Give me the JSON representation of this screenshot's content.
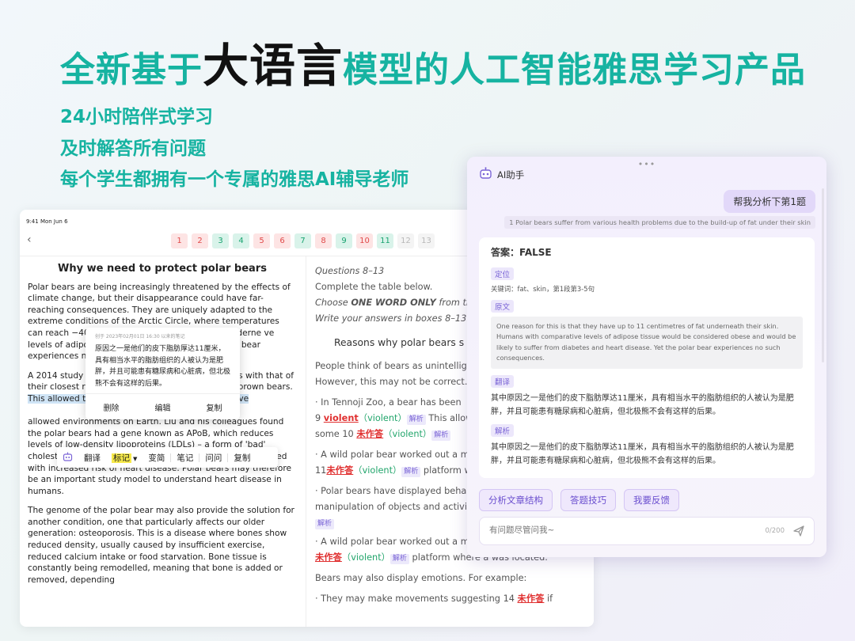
{
  "headline": {
    "pre": "全新基于",
    "em": "大语言",
    "post": "模型的人工智能雅思学习产品"
  },
  "subtitles": [
    "24小时陪伴式学习",
    "及时解答所有问题",
    "每个学生都拥有一个专属的雅思AI辅导老师"
  ],
  "tablet": {
    "status": "9:41  Mon Jun 6",
    "back_icon": "chevron-left-icon",
    "questions": [
      {
        "n": "1",
        "state": "wrong"
      },
      {
        "n": "2",
        "state": "wrong"
      },
      {
        "n": "3",
        "state": "right"
      },
      {
        "n": "4",
        "state": "right"
      },
      {
        "n": "5",
        "state": "wrong"
      },
      {
        "n": "6",
        "state": "wrong"
      },
      {
        "n": "7",
        "state": "right"
      },
      {
        "n": "8",
        "state": "wrong"
      },
      {
        "n": "9",
        "state": "right"
      },
      {
        "n": "10",
        "state": "wrong"
      },
      {
        "n": "11",
        "state": "right"
      },
      {
        "n": "12",
        "state": "empty"
      },
      {
        "n": "13",
        "state": "empty"
      }
    ],
    "article": {
      "title": "Why we need to protect polar bears",
      "p1": "Polar bears are being increasingly threatened by the effects of climate change, but their disappearance could have far-reaching consequences. They are uniquely adapted to the extreme conditions of the Arctic Circle, where temperatures can reach −40°C. One re                                                  11 centimetres of fat underne                                                 ve levels of adipose tissue                                                    be likely to suffer from dia                                                  bear experiences no",
      "p2a": "A 2014 study b                                            ight on this mystery. They                                                lar bears with that of their closest relatives from a warmer climate, the brown bears. ",
      "p2hl": "This allowed them to determine the genes that have",
      "p2b": "allowed                                                                          environments on Earth. Liu and his colleagues found the polar bears had a gene known as APoB, which reduces levels of low-density lipoproteins (LDLs) – a form of 'bad' cholesterol. In humans, mutations of this gene are associated with increased risk of heart disease. Polar bears may therefore be an important study model to understand heart disease in humans.",
      "p3": "The genome of the polar bear may also provide the solution for another condition, one that particularly affects our older generation: osteoporosis. This is a disease where bones show reduced density, usually caused by insufficient exercise, reduced calcium intake or food starvation. Bone tissue is constantly being remodelled, meaning that bone is added or removed, depending"
    },
    "questions_panel": {
      "heading": "Questions 8–13",
      "instr1": "Complete the table below.",
      "instr2_pre": "Choose ",
      "instr2_bold": "ONE WORD ONLY",
      "instr2_post": " from the",
      "instr3": "Write your answers in boxes 8–13.",
      "section": "Reasons why polar bears s",
      "l1": "People think of bears as unintellig",
      "l2": "However, this may not be correct.",
      "l3": "· In Tennoji Zoo, a bear has been",
      "q9_num": "9",
      "q9_ans": "violent",
      "q9_correct": "（violent）",
      "q9_tag": "解析",
      "q9_tail": " This allow",
      "q10_pre": "some 10 ",
      "q10_ans": "未作答",
      "q10_correct": "（violent）",
      "q10_tag": "解析",
      "l4": "· A wild polar bear worked out a m",
      "q11_num": "11",
      "q11_ans": "未作答",
      "q11_correct": "（violent）",
      "q11_tag": "解析",
      "q11_tail": " platform w",
      "l5": "· Polar bears have displayed beha",
      "l6": "manipulation of objects and activi",
      "tag_solo": "解析",
      "l7": "· A wild polar bear worked out a m",
      "q12_ans": "未作答",
      "q12_correct": "（violent）",
      "q12_tag": "解析",
      "q12_tail": " platform where a was located.",
      "l8": "Bears may also display emotions. For example:",
      "l9": "· They may make movements suggesting 14 ",
      "q14_ans": "未作答",
      "q14_tail": " if"
    }
  },
  "note_popup": {
    "meta": "创于 2023年02月01日 16:30 以来的笔记",
    "text": "原因之一是他们的皮下脂肪厚达11厘米，具有相当水平的脂肪组织的人被认为是肥胖，并且可能患有糖尿病和心脏病，但北极熊不会有这样的后果。",
    "actions": [
      "删除",
      "编辑",
      "复制"
    ]
  },
  "sel_toolbar": {
    "items": [
      "翻译",
      "标记",
      "变简",
      "笔记",
      "问问",
      "复制"
    ]
  },
  "ai": {
    "title": "AI助手",
    "user_msg": "帮我分析下第1题",
    "quote": "1 Polar bears suffer from various health problems due to the build-up of fat under their skin",
    "answer": {
      "head": "答案：FALSE",
      "l_locate": "定位",
      "keywords": "关键词：fat、skin，第1段第3-5句",
      "l_orig": "原文",
      "orig": "One reason for this is that they have up to 11 centimetres of fat underneath their skin. Humans with comparative levels of adipose tissue would be considered obese and would be likely to suffer from diabetes and heart disease. Yet the polar bear experiences no such consequences.",
      "l_trans": "翻译",
      "trans": "其中原因之一是他们的皮下脂肪厚达11厘米，具有相当水平的脂肪组织的人被认为是肥胖，并且可能患有糖尿病和心脏病，但北极熊不会有这样的后果。",
      "l_analysis": "解析",
      "analysis": "其中原因之一是他们的皮下脂肪厚达11厘米，具有相当水平的脂肪组织的人被认为是肥胖，并且可能患有糖尿病和心脏病，但北极熊不会有这样的后果。"
    },
    "chips": [
      "分析文章结构",
      "答题技巧",
      "我要反馈"
    ],
    "input_placeholder": "有问题尽管问我~",
    "counter": "0/200"
  }
}
